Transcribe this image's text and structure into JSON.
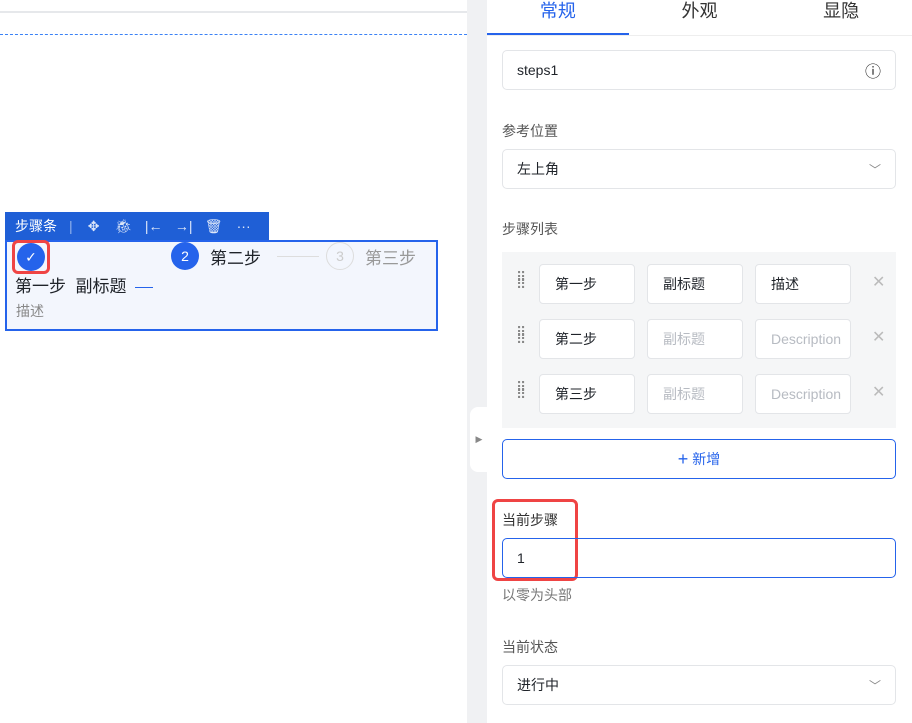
{
  "canvas": {
    "toolbar": {
      "title": "步骤条",
      "icons": [
        "move-icon",
        "bug-icon",
        "align-left-icon",
        "align-right-icon",
        "delete-icon",
        "more-icon"
      ]
    },
    "steps": [
      {
        "title": "第一步",
        "subtitle": "副标题",
        "description": "描述",
        "icon": "check-icon"
      },
      {
        "number": "2",
        "title": "第二步"
      },
      {
        "number": "3",
        "title": "第三步"
      }
    ]
  },
  "panel": {
    "tabs": [
      {
        "label": "常规"
      },
      {
        "label": "外观"
      },
      {
        "label": "显隐"
      }
    ],
    "name_value": "steps1",
    "position_label": "参考位置",
    "position_value": "左上角",
    "steps_label": "步骤列表",
    "steps": [
      {
        "title": "第一步",
        "subtitle": "副标题",
        "description": "描述"
      },
      {
        "title": "第二步",
        "subtitle_placeholder": "副标题",
        "description_placeholder": "Description"
      },
      {
        "title": "第三步",
        "subtitle_placeholder": "副标题",
        "description_placeholder": "Description"
      }
    ],
    "add_label": "新增",
    "current_label": "当前步骤",
    "current_value": "1",
    "current_hint": "以零为头部",
    "status_label": "当前状态",
    "status_value": "进行中"
  },
  "colors": {
    "accent": "#2563eb",
    "highlight": "#ef4444"
  }
}
